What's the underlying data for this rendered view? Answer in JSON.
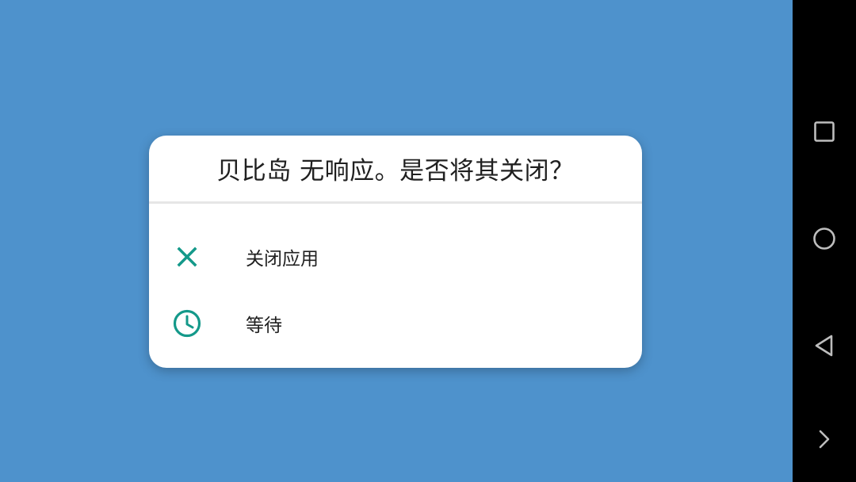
{
  "dialog": {
    "title": "贝比岛 无响应。是否将其关闭？",
    "options": [
      {
        "label": "关闭应用",
        "icon": "close-icon"
      },
      {
        "label": "等待",
        "icon": "clock-icon"
      }
    ]
  },
  "navbar": {
    "buttons": [
      "recents-icon",
      "home-icon",
      "back-icon",
      "chevron-right-icon"
    ]
  },
  "colors": {
    "background": "#4e92cc",
    "accent": "#14998a",
    "navbar": "#000000"
  }
}
